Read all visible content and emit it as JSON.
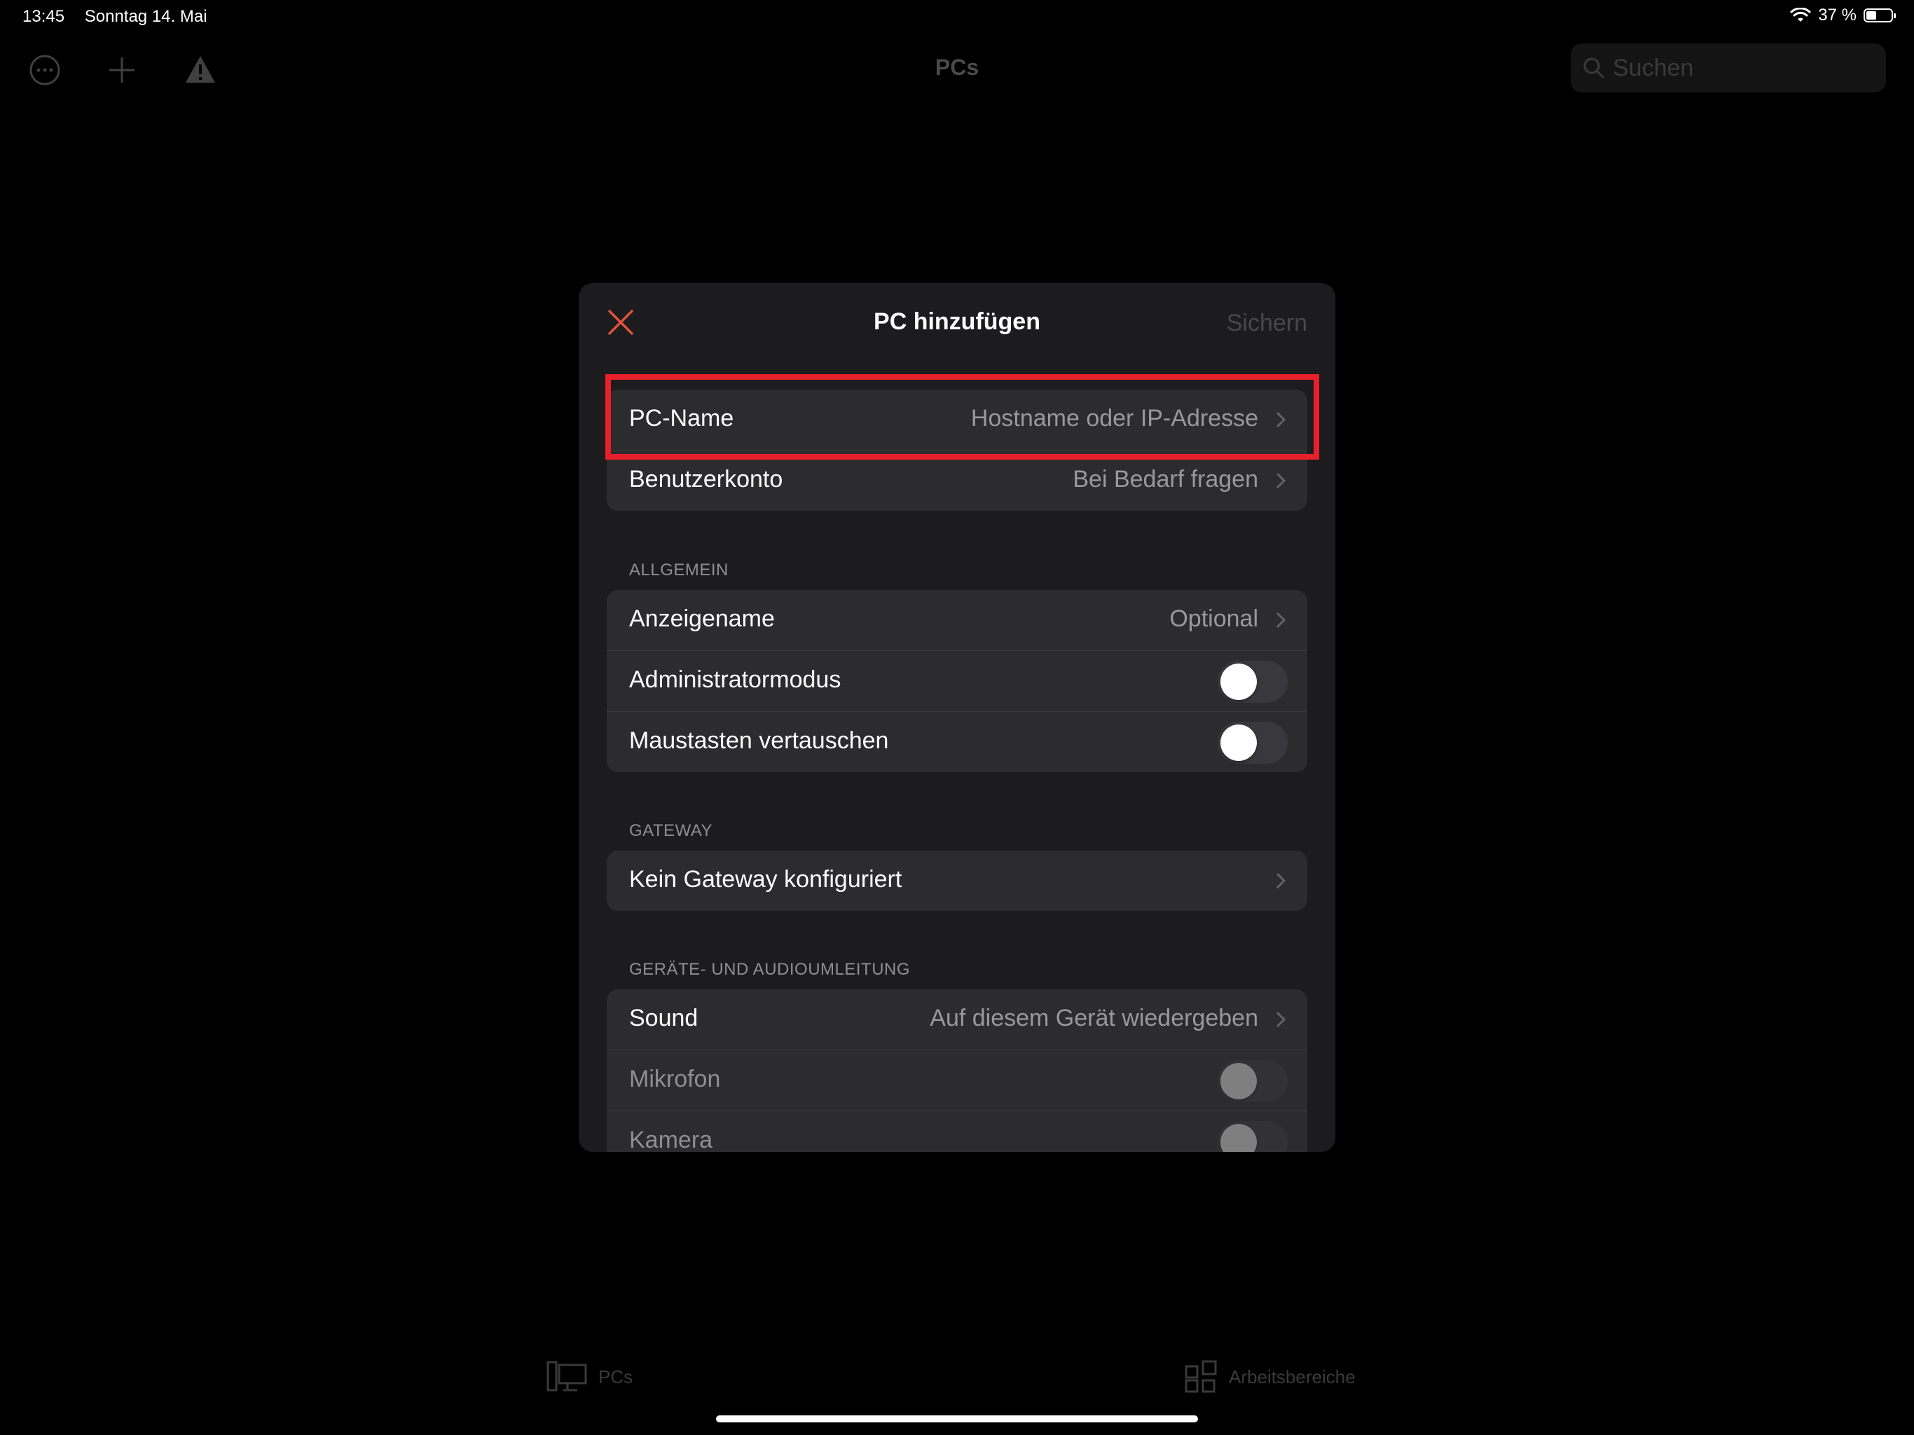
{
  "status_bar": {
    "time": "13:45",
    "date": "Sonntag 14. Mai",
    "battery_text": "37 %",
    "battery_level": 0.37
  },
  "top_bar": {
    "title": "PCs",
    "search_placeholder": "Suchen",
    "icons": [
      "more-icon",
      "add-icon",
      "warning-icon"
    ]
  },
  "modal": {
    "title": "PC hinzufügen",
    "close_icon": "close-icon",
    "save_label": "Sichern",
    "primary": [
      {
        "label": "PC-Name",
        "value": "Hostname oder IP-Adresse"
      },
      {
        "label": "Benutzerkonto",
        "value": "Bei Bedarf fragen"
      }
    ],
    "general": {
      "header": "ALLGEMEIN",
      "display_name": {
        "label": "Anzeigename",
        "value": "Optional"
      },
      "admin_mode": {
        "label": "Administratormodus",
        "on": false
      },
      "swap_mouse": {
        "label": "Maustasten vertauschen",
        "on": false
      }
    },
    "gateway": {
      "header": "GATEWAY",
      "row": {
        "label": "Kein Gateway konfiguriert"
      }
    },
    "redirection": {
      "header": "GERÄTE- UND AUDIOUMLEITUNG",
      "sound": {
        "label": "Sound",
        "value": "Auf diesem Gerät wiedergeben"
      },
      "microphone": {
        "label": "Mikrofon",
        "on": false,
        "disabled": true
      },
      "camera": {
        "label": "Kamera",
        "on": false,
        "disabled": true
      }
    }
  },
  "tab_bar": {
    "pcs": "PCs",
    "workspaces": "Arbeitsbereiche"
  },
  "colors": {
    "accent_close": "#e0523a",
    "highlight": "#e8202a"
  }
}
